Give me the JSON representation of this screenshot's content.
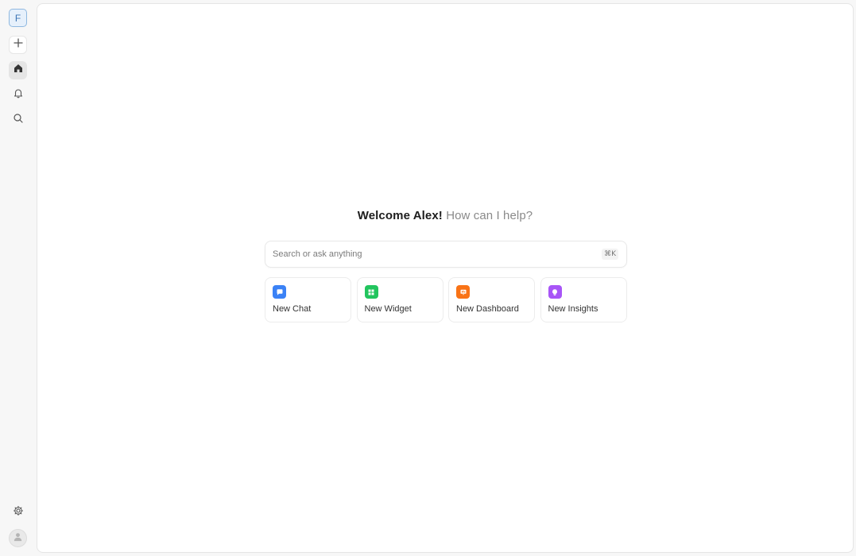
{
  "sidebar": {
    "workspace_initial": "F",
    "items": [
      {
        "name": "new",
        "icon": "plus-icon"
      },
      {
        "name": "home",
        "icon": "home-icon",
        "active": true
      },
      {
        "name": "notifications",
        "icon": "bell-icon"
      },
      {
        "name": "search",
        "icon": "search-icon"
      }
    ],
    "bottom": [
      {
        "name": "settings",
        "icon": "gear-icon"
      },
      {
        "name": "profile",
        "icon": "user-avatar-icon"
      }
    ]
  },
  "main": {
    "welcome_strong": "Welcome Alex!",
    "welcome_muted": "How can I help?",
    "search": {
      "placeholder": "Search or ask anything",
      "shortcut": "⌘K"
    },
    "cards": [
      {
        "label": "New Chat",
        "icon": "chat-icon",
        "color": "#3b82f6"
      },
      {
        "label": "New Widget",
        "icon": "grid-icon",
        "color": "#22c55e"
      },
      {
        "label": "New Dashboard",
        "icon": "dashboard-icon",
        "color": "#f97316"
      },
      {
        "label": "New Insights",
        "icon": "lightbulb-icon",
        "color": "#a855f7"
      }
    ]
  }
}
